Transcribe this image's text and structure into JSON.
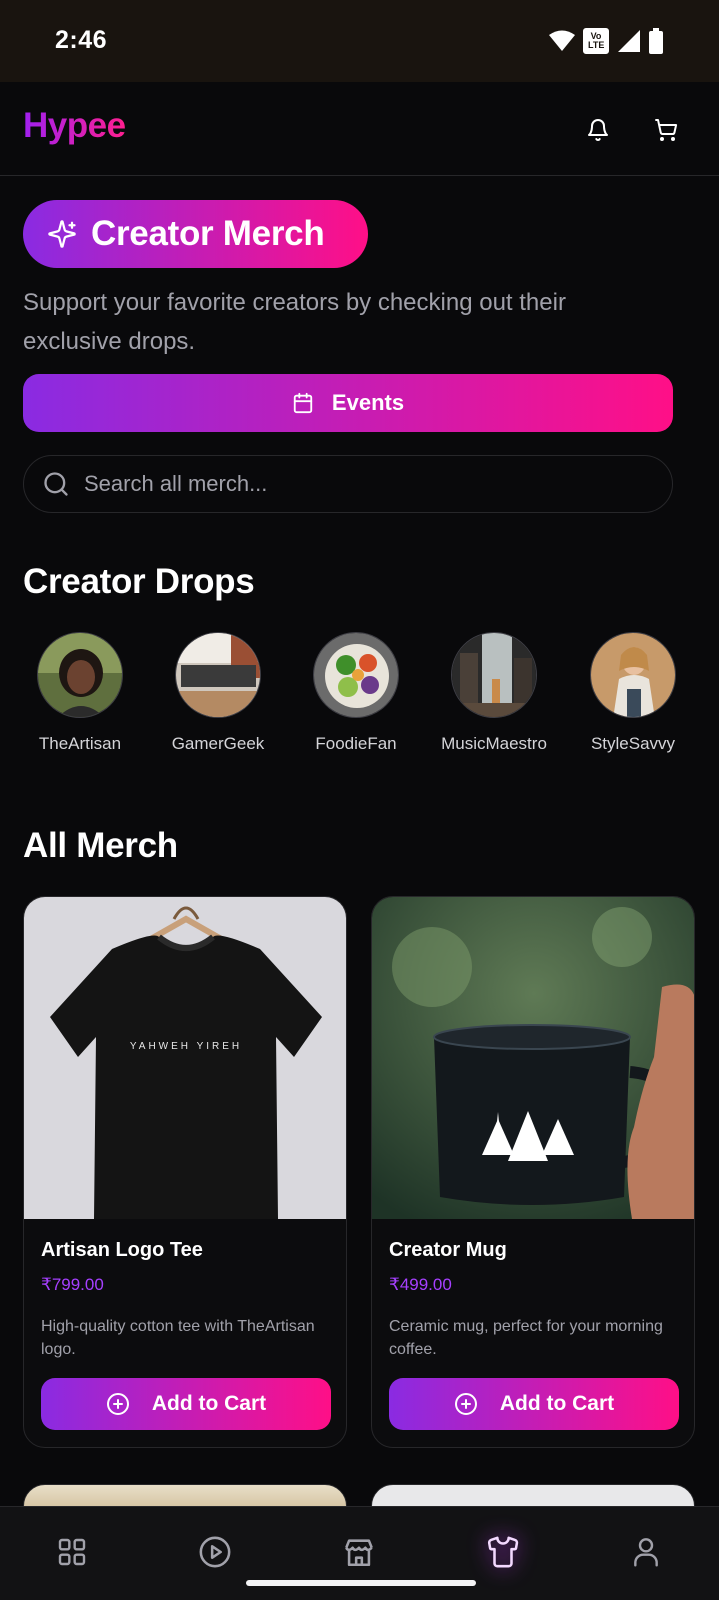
{
  "status_bar": {
    "time": "2:46",
    "network_badge": "Vo LTE"
  },
  "header": {
    "logo": "Hypee",
    "icons": [
      "bell-icon",
      "cart-icon"
    ]
  },
  "hero": {
    "pill_label": "Creator Merch",
    "subtitle": "Support your favorite creators by checking out their exclusive drops.",
    "events_button": "Events"
  },
  "search": {
    "placeholder": "Search all merch...",
    "value": ""
  },
  "creator_drops": {
    "title": "Creator Drops",
    "creators": [
      {
        "name": "TheArtisan"
      },
      {
        "name": "GamerGeek"
      },
      {
        "name": "FoodieFan"
      },
      {
        "name": "MusicMaestro"
      },
      {
        "name": "StyleSavvy"
      }
    ]
  },
  "all_merch": {
    "title": "All Merch",
    "products": [
      {
        "name": "Artisan Logo Tee",
        "price": "₹799.00",
        "description": "High-quality cotton tee with TheArtisan logo.",
        "button": "Add to Cart",
        "print_text": "YAHWEH YIREH"
      },
      {
        "name": "Creator Mug",
        "price": "₹499.00",
        "description": "Ceramic mug, perfect for your morning coffee.",
        "button": "Add to Cart"
      }
    ]
  },
  "bottom_nav": {
    "items": [
      "grid-icon",
      "play-icon",
      "store-icon",
      "shirt-icon",
      "user-icon"
    ],
    "active": "shirt-icon"
  },
  "colors": {
    "background": "#09090b",
    "gradient_start": "#8a2be2",
    "gradient_end": "#ff0f87",
    "price": "#a640ff",
    "muted_text": "#a1a1aa"
  }
}
